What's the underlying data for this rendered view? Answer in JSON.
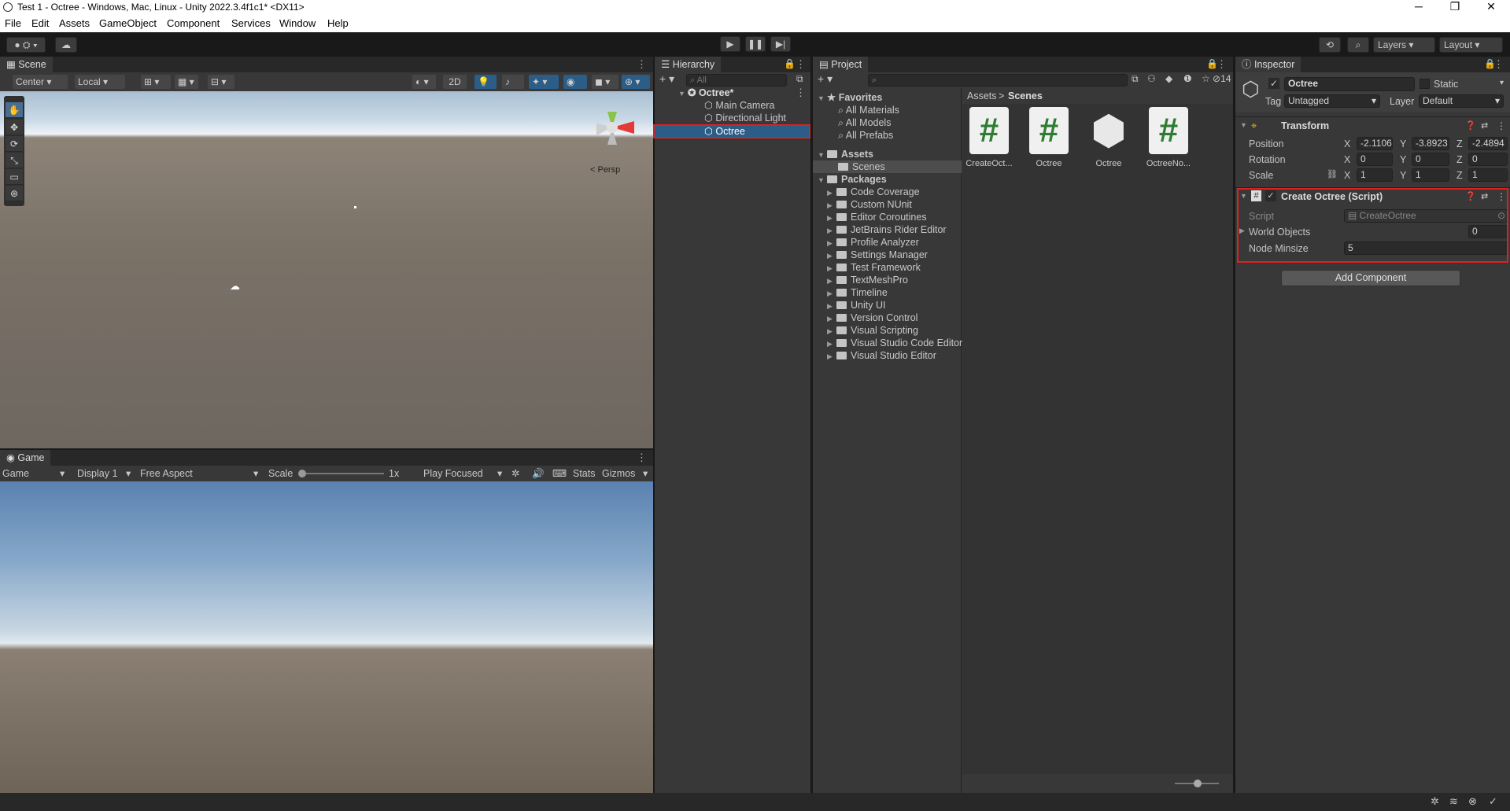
{
  "window": {
    "title": "Test 1 - Octree - Windows, Mac, Linux - Unity 2022.3.4f1c1* <DX11>",
    "minimize": "─",
    "maximize": "❐",
    "close": "✕"
  },
  "menu": [
    "File",
    "Edit",
    "Assets",
    "GameObject",
    "Component",
    "Services",
    "Window",
    "Help"
  ],
  "toolbar": {
    "layers": "Layers",
    "layout": "Layout",
    "play": "▶",
    "pause": "❚❚",
    "step": "▶|"
  },
  "scene": {
    "tab": "Scene",
    "pivot": "Center",
    "space": "Local",
    "mode2d": "2D",
    "persp": "< Persp"
  },
  "game": {
    "tab": "Game",
    "view": "Game",
    "display": "Display 1",
    "aspect": "Free Aspect",
    "scale_label": "Scale",
    "scale_value": "1x",
    "play_mode": "Play Focused",
    "stats": "Stats",
    "gizmos": "Gizmos"
  },
  "hierarchy": {
    "tab": "Hierarchy",
    "search_placeholder": "All",
    "scene": "Octree*",
    "items": [
      "Main Camera",
      "Directional Light",
      "Octree"
    ]
  },
  "project": {
    "tab": "Project",
    "favorites_label": "Favorites",
    "favorites": [
      "All Materials",
      "All Models",
      "All Prefabs"
    ],
    "assets_label": "Assets",
    "assets_children": [
      "Scenes"
    ],
    "packages_label": "Packages",
    "packages": [
      "Code Coverage",
      "Custom NUnit",
      "Editor Coroutines",
      "JetBrains Rider Editor",
      "Profile Analyzer",
      "Settings Manager",
      "Test Framework",
      "TextMeshPro",
      "Timeline",
      "Unity UI",
      "Version Control",
      "Visual Scripting",
      "Visual Studio Code Editor",
      "Visual Studio Editor"
    ],
    "breadcrumb_root": "Assets",
    "breadcrumb_sep": ">",
    "breadcrumb_current": "Scenes",
    "hidden_count": "14",
    "files": [
      "CreateOct...",
      "Octree",
      "Octree",
      "OctreeNo..."
    ]
  },
  "inspector": {
    "tab": "Inspector",
    "object_name": "Octree",
    "static_label": "Static",
    "tag_label": "Tag",
    "tag": "Untagged",
    "layer_label": "Layer",
    "layer": "Default",
    "transform": {
      "title": "Transform",
      "position_label": "Position",
      "rotation_label": "Rotation",
      "scale_label": "Scale",
      "position": [
        "-2.1106",
        "-3.8923",
        "-2.4894"
      ],
      "rotation": [
        "0",
        "0",
        "0"
      ],
      "scale": [
        "1",
        "1",
        "1"
      ],
      "axes": [
        "X",
        "Y",
        "Z"
      ]
    },
    "script": {
      "title": "Create Octree (Script)",
      "script_label": "Script",
      "script_value": "CreateOctree",
      "world_objects_label": "World Objects",
      "world_objects": "0",
      "node_minsize_label": "Node Minsize",
      "node_minsize": "5"
    },
    "add_component": "Add Component"
  },
  "colors": {
    "accent": "#2c5d87",
    "highlight": "#e02020",
    "panel": "#383838",
    "dark": "#191919"
  }
}
